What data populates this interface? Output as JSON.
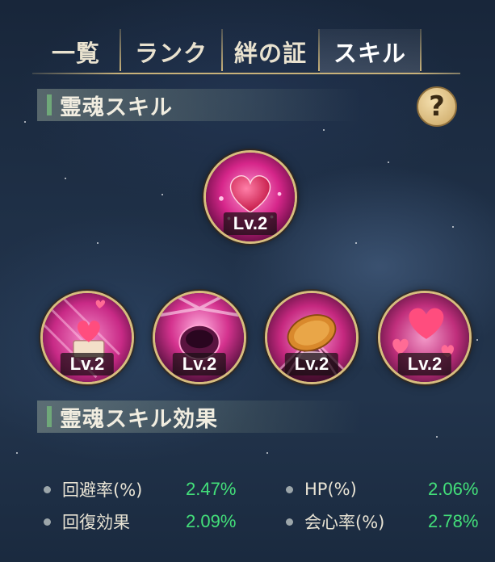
{
  "tabs": [
    {
      "label": "一覧"
    },
    {
      "label": "ランク"
    },
    {
      "label": "絆の証"
    },
    {
      "label": "スキル",
      "active": true
    }
  ],
  "soul_skill": {
    "title": "霊魂スキル",
    "help_label": "?",
    "skills": [
      {
        "level": "Lv.2",
        "icon": "heart-glow-icon"
      },
      {
        "level": "Lv.2",
        "icon": "heart-gift-box-icon"
      },
      {
        "level": "Lv.2",
        "icon": "pink-burst-icon"
      },
      {
        "level": "Lv.2",
        "icon": "golden-flower-icon"
      },
      {
        "level": "Lv.2",
        "icon": "floating-hearts-icon"
      }
    ]
  },
  "soul_skill_effects": {
    "title": "霊魂スキル効果",
    "items": [
      {
        "label": "回避率(%)",
        "value": "2.47%"
      },
      {
        "label": "HP(%)",
        "value": "2.06%"
      },
      {
        "label": "回復効果",
        "value": "2.09%"
      },
      {
        "label": "会心率(%)",
        "value": "2.78%"
      }
    ]
  },
  "colors": {
    "accent_gold": "#c9b27a",
    "value_green": "#43e07a",
    "section_bar": "#6fa879",
    "skill_pink": "#e0358f"
  }
}
